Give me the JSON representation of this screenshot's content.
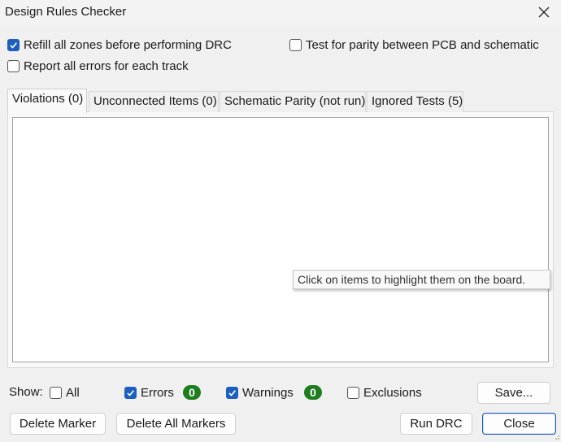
{
  "window": {
    "title": "Design Rules Checker"
  },
  "options": {
    "refill_zones": {
      "label": "Refill all zones before performing DRC",
      "checked": true
    },
    "report_all_errors": {
      "label": "Report all errors for each track",
      "checked": false
    },
    "test_parity": {
      "label": "Test for parity between PCB and schematic",
      "checked": false
    }
  },
  "tabs": [
    {
      "label": "Violations (0)",
      "active": true
    },
    {
      "label": "Unconnected Items (0)",
      "active": false
    },
    {
      "label": "Schematic Parity (not run)",
      "active": false
    },
    {
      "label": "Ignored Tests (5)",
      "active": false
    }
  ],
  "tooltip": "Click on items to highlight them on the board.",
  "filter": {
    "show_label": "Show:",
    "all": {
      "label": "All",
      "checked": false
    },
    "errors": {
      "label": "Errors",
      "checked": true,
      "count": "0"
    },
    "warnings": {
      "label": "Warnings",
      "checked": true,
      "count": "0"
    },
    "exclusions": {
      "label": "Exclusions",
      "checked": false
    }
  },
  "buttons": {
    "save": "Save...",
    "delete_marker": "Delete Marker",
    "delete_all_markers": "Delete All Markers",
    "run_drc": "Run DRC",
    "close": "Close"
  },
  "colors": {
    "accent": "#1d5fbf",
    "badge": "#1e7d1e"
  }
}
